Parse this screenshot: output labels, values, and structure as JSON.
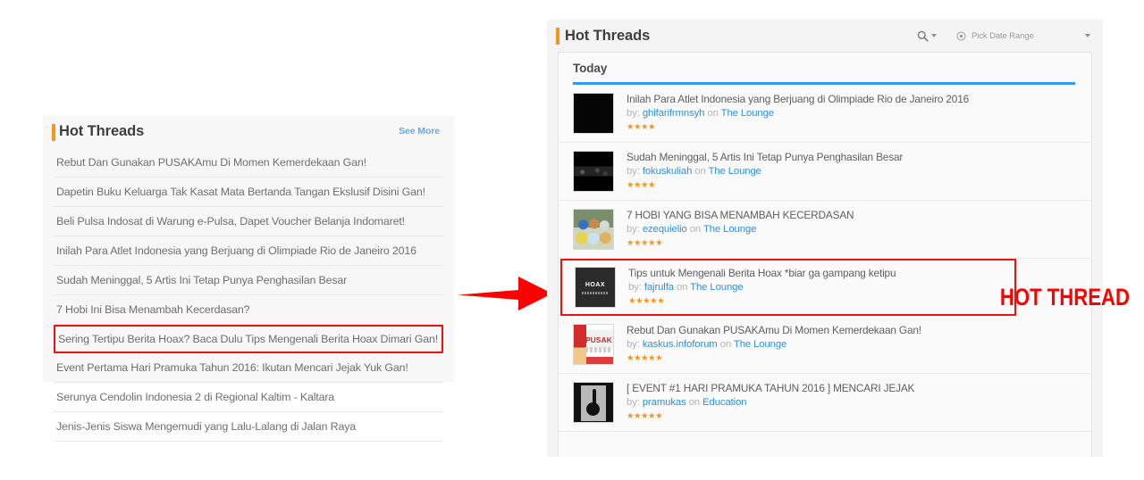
{
  "left_panel": {
    "title": "Hot Threads",
    "see_more_label": "See More",
    "accent_color": "#f7941e",
    "highlight_color": "#ee1111",
    "threads": [
      {
        "title": "Rebut Dan Gunakan PUSAKAmu Di Momen Kemerdekaan Gan!",
        "highlighted": false
      },
      {
        "title": "Dapetin Buku Keluarga Tak Kasat Mata Bertanda Tangan Ekslusif Disini Gan!",
        "highlighted": false
      },
      {
        "title": "Beli Pulsa Indosat di Warung e-Pulsa, Dapet Voucher Belanja Indomaret!",
        "highlighted": false
      },
      {
        "title": "Inilah Para Atlet Indonesia yang Berjuang di Olimpiade Rio de Janeiro 2016",
        "highlighted": false
      },
      {
        "title": "Sudah Meninggal, 5 Artis Ini Tetap Punya Penghasilan Besar",
        "highlighted": false
      },
      {
        "title": "7 Hobi Ini Bisa Menambah Kecerdasan?",
        "highlighted": false
      },
      {
        "title": "Sering Tertipu Berita Hoax? Baca Dulu Tips Mengenali Berita Hoax Dimari Gan!",
        "highlighted": true
      },
      {
        "title": "Event Pertama Hari Pramuka Tahun 2016: Ikutan Mencari Jejak Yuk Gan!",
        "highlighted": false
      },
      {
        "title": "Serunya Cendolin Indonesia 2 di Regional Kaltim - Kaltara",
        "highlighted": false
      },
      {
        "title": "Jenis-Jenis Siswa Mengemudi yang Lalu-Lalang di Jalan Raya",
        "highlighted": false
      }
    ]
  },
  "annotation": {
    "arrow_icon": "right-arrow-icon",
    "arrow_color": "#ff0000",
    "badge_label": "HOT THREAD",
    "badge_color": "#ff0000"
  },
  "right_panel": {
    "title": "Hot Threads",
    "accent_color": "#f7941e",
    "search_icon": "search-icon",
    "date_range": {
      "icon": "target-icon",
      "label": "Pick Date Range"
    },
    "section_label": "Today",
    "section_underline_color": "#3498f0",
    "star_color": "#f7941e",
    "by_label": "by:",
    "on_label": "on",
    "threads": [
      {
        "title": "Inilah Para Atlet Indonesia yang Berjuang di Olimpiade Rio de Janeiro 2016",
        "author": "ghifarifrmnsyh",
        "forum": "The Lounge",
        "stars": 4,
        "stars_text": "★★★★",
        "thumb": "black-thumbnail",
        "highlighted": false
      },
      {
        "title": "Sudah Meninggal, 5 Artis Ini Tetap Punya Penghasilan Besar",
        "author": "fokuskuliah",
        "forum": "The Lounge",
        "stars": 4,
        "stars_text": "★★★★",
        "thumb": "dark-photo-thumbnail",
        "highlighted": false
      },
      {
        "title": "7 HOBI YANG BISA MENAMBAH KECERDASAN",
        "author": "ezequielio",
        "forum": "The Lounge",
        "stars": 5,
        "stars_text": "★★★★★",
        "thumb": "cartoon-kids-thumbnail",
        "highlighted": false
      },
      {
        "title": "Tips untuk Mengenali Berita Hoax *biar ga gampang ketipu",
        "author": "fajrulfa",
        "forum": "The Lounge",
        "stars": 5,
        "stars_text": "★★★★★",
        "thumb": "hoax-thumbnail",
        "thumb_text": "HOAX",
        "highlighted": true
      },
      {
        "title": "Rebut Dan Gunakan PUSAKAmu Di Momen Kemerdekaan Gan!",
        "author": "kaskus.infoforum",
        "forum": "The Lounge",
        "stars": 5,
        "stars_text": "★★★★★",
        "thumb": "pusaka-banner-thumbnail",
        "thumb_text": "PUSAKA",
        "highlighted": false
      },
      {
        "title": "[ EVENT #1 HARI PRAMUKA TAHUN 2016 ] MENCARI JEJAK",
        "author": "pramukas",
        "forum": "Education",
        "stars": 5,
        "stars_text": "★★★★★",
        "thumb": "pramuka-logo-thumbnail",
        "highlighted": false
      }
    ]
  }
}
